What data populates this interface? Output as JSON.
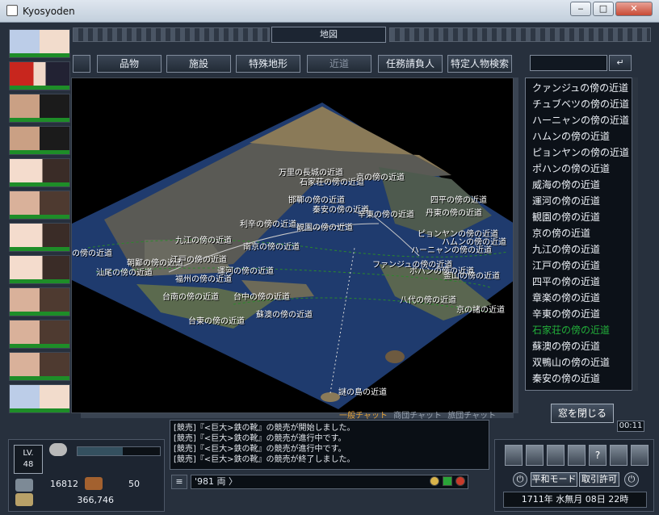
{
  "window": {
    "title": "Kyosyoden",
    "minimize_label": "‒",
    "maximize_label": "□",
    "close_label": "✕"
  },
  "map_header": {
    "title": "地図"
  },
  "categories": [
    {
      "label": "品物",
      "enabled": true
    },
    {
      "label": "施設",
      "enabled": true
    },
    {
      "label": "特殊地形",
      "enabled": true
    },
    {
      "label": "近道",
      "enabled": false
    },
    {
      "label": "任務請負人",
      "enabled": true
    },
    {
      "label": "特定人物検索",
      "enabled": true
    }
  ],
  "search": {
    "value": "",
    "enter_label": "↵"
  },
  "map_controls": {
    "reset_label": "⊗",
    "zoom_in_label": "+",
    "zoom_out_label": "−"
  },
  "map_labels": [
    "万里の長城の近道",
    "石家荘の傍の近道",
    "京の傍の近道",
    "四平の傍の近道",
    "邯鄲の傍の近道",
    "秦安の傍の近道",
    "辛東の傍の近道",
    "丹東の傍の近道",
    "利辛の傍の近道",
    "観園の傍の近道",
    "九江の傍の近道",
    "南京の傍の近道",
    "ピョンヤンの傍の近道",
    "ハムンの傍の近道",
    "ハーニャンの傍の近道",
    "の傍の近道",
    "朝鄙の傍の近道",
    "江戸の傍の近道",
    "運河の傍の近道",
    "汕尾の傍の近道",
    "福州の傍の近道",
    "ファンジュの傍の近道",
    "ポハンの傍の近道",
    "釜山の傍の近道",
    "台南の傍の近道",
    "台中の傍の近道",
    "八代の傍の近道",
    "蘇澳の傍の近道",
    "京の諸の近道",
    "台東の傍の近道",
    "謎の島の近道"
  ],
  "route_list": {
    "items": [
      "クァンジュの傍の近道",
      "チュブベツの傍の近道",
      "ハーニャンの傍の近道",
      "ハムンの傍の近道",
      "ピョンヤンの傍の近道",
      "ポハンの傍の近道",
      "威海の傍の近道",
      "運河の傍の近道",
      "観園の傍の近道",
      "京の傍の近道",
      "九江の傍の近道",
      "江戸の傍の近道",
      "四平の傍の近道",
      "章楽の傍の近道",
      "辛東の傍の近道",
      "石家荘の傍の近道",
      "蘇澳の傍の近道",
      "双鴨山の傍の近道",
      "秦安の傍の近道"
    ],
    "selected_index": 15,
    "selected_color": "#22b03a"
  },
  "close_window_label": "窓を閉じる",
  "timer": "00:11",
  "chat": {
    "tabs": [
      "一般チャット",
      "商団チャット",
      "旅団チャット"
    ],
    "active_tab": 0,
    "active_color": "#e4a23a",
    "lines": [
      "[競売]『<巨大>鉄の靴』の競売が開始しました。",
      "[競売]『<巨大>鉄の靴』の競売が進行中です。",
      "[競売]『<巨大>鉄の靴』の競売が進行中です。",
      "[競売]『<巨大>鉄の靴』の競売が終了しました。"
    ],
    "input_value": "'981 両 〉",
    "menu_icon": "hamburger-icon"
  },
  "stats": {
    "level_label": "LV.",
    "level": "48",
    "exp_fraction": 0.55,
    "gold": "16812",
    "items": "50",
    "money": "366,746"
  },
  "commands": {
    "icons": [
      "backpack-icon",
      "sword-icon",
      "scroll-icon",
      "feather-icon",
      "help-icon",
      "party-icon",
      "phone-icon"
    ],
    "help_label": "?",
    "mode_label": "平和モード",
    "trade_label": "取引許可"
  },
  "date": "1711年 水無月 08日 22時",
  "colors": {
    "hp_green": "#1e8d28",
    "sea": "#1f3b6e",
    "land": "#8a7a58",
    "route_line": "#2b8a2b"
  }
}
